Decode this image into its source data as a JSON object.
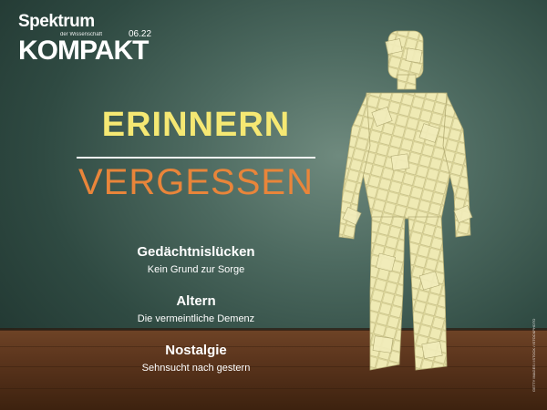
{
  "brand": {
    "name": "Spektrum",
    "subtitle": "der Wissenschaft",
    "series": "KOMPAKT",
    "issue": "06.22"
  },
  "headline": {
    "primary": "ERINNERN",
    "secondary": "VERGESSEN"
  },
  "topics": [
    {
      "title": "Gedächtnislücken",
      "subtitle": "Kein Grund zur Sorge"
    },
    {
      "title": "Altern",
      "subtitle": "Die vermeintliche Demenz"
    },
    {
      "title": "Nostalgie",
      "subtitle": "Sehnsucht nach gestern"
    }
  ],
  "colors": {
    "primary_title": "#f5e873",
    "secondary_title": "#e9853a",
    "background_green": "#3b5a50",
    "sticky_note": "#e9e4a6"
  },
  "image": {
    "subject": "sticky-note-covered-figure"
  },
  "credit": "GETTY IMAGES / ISTOCK / ISTOCKPHOTO"
}
